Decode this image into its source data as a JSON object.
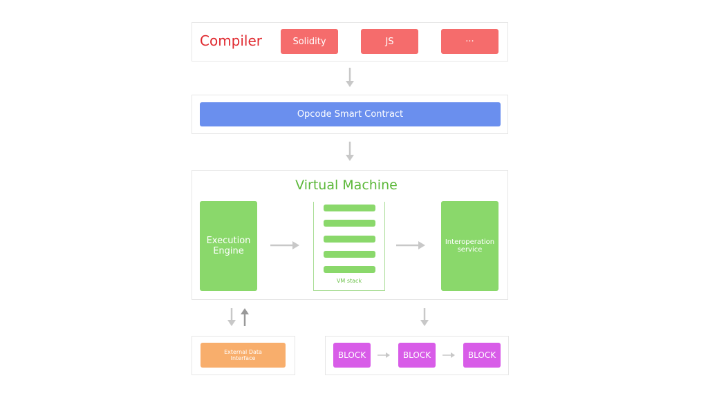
{
  "compiler": {
    "title": "Compiler",
    "languages": [
      "Solidity",
      "JS",
      "···"
    ]
  },
  "opcode": {
    "label": "Opcode Smart Contract"
  },
  "vm": {
    "title": "Virtual Machine",
    "execution_engine": "Execution Engine",
    "stack_label": "VM stack",
    "interop": "Interoperation service"
  },
  "external": {
    "label": "External Data Interface"
  },
  "blocks": [
    "BLOCK",
    "BLOCK",
    "BLOCK"
  ],
  "colors": {
    "compiler": "#f56c6c",
    "opcode": "#6a8fee",
    "vm": "#8ad86b",
    "external": "#f8ae6c",
    "block": "#d85ce8",
    "title_red": "#e0292f",
    "title_green": "#5cb83a"
  }
}
